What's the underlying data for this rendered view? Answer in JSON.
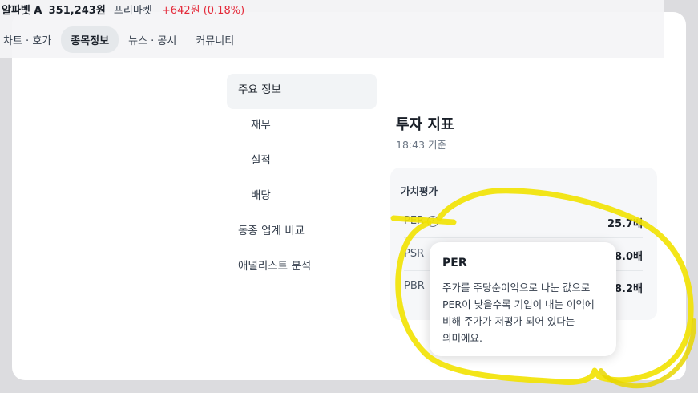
{
  "header": {
    "stock_name": "알파벳 A",
    "price": "351,243원",
    "market": "프리마켓",
    "change": "+642원 (0.18%)",
    "colors": {
      "up": "#e42939"
    }
  },
  "tabs": [
    {
      "label": "차트 · 호가"
    },
    {
      "label": "종목정보",
      "active": true
    },
    {
      "label": "뉴스 · 공시"
    },
    {
      "label": "커뮤니티"
    }
  ],
  "sidebar": {
    "items": [
      {
        "label": "주요 정보",
        "active": true
      },
      {
        "label": "재무"
      },
      {
        "label": "실적"
      },
      {
        "label": "배당"
      },
      {
        "label": "동종 업계 비교"
      },
      {
        "label": "애널리스트 분석"
      }
    ]
  },
  "section": {
    "title": "투자 지표",
    "subtitle": "18:43 기준"
  },
  "valuation": {
    "title": "가치평가",
    "rows": [
      {
        "label": "PER",
        "value": "25.7배"
      },
      {
        "label": "PSR",
        "value": "8.0배"
      },
      {
        "label": "PBR",
        "value": "8.2배"
      }
    ],
    "help_icon": "question-circle-icon"
  },
  "tooltip": {
    "title": "PER",
    "lines": [
      "주가를 주당순이익으로 나눈 값으로",
      "PER이 낮을수록 기업이 내는 이익에",
      "비해 주가가 저평가 되어 있다는",
      "의미에요."
    ]
  },
  "annotation": {
    "color": "#f2e200"
  }
}
